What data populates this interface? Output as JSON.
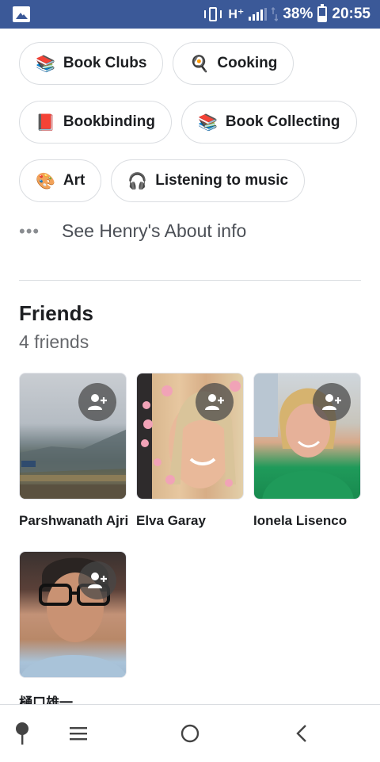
{
  "status_bar": {
    "network_label": "H⁺",
    "battery_percent": "38%",
    "battery_level": 0.38,
    "time": "20:55",
    "color": "#3b5998",
    "icons": [
      "gallery-icon",
      "vibrate-icon",
      "signal-icon",
      "data-arrows-icon",
      "battery-charging-icon"
    ]
  },
  "interests": [
    {
      "emoji": "📚",
      "label": "Book Clubs"
    },
    {
      "emoji": "🍳",
      "label": "Cooking"
    },
    {
      "emoji": "📕",
      "label": "Bookbinding"
    },
    {
      "emoji": "📚",
      "label": "Book Collecting"
    },
    {
      "emoji": "🎨",
      "label": "Art"
    },
    {
      "emoji": "🎧",
      "label": "Listening to music"
    }
  ],
  "about_link": {
    "icon": "more-dots-icon",
    "label": "See Henry's About info"
  },
  "friends": {
    "title": "Friends",
    "count_label": "4 friends",
    "add_friend_icon": "add-friend-icon",
    "list": [
      {
        "name": "Parshwanath Ajri"
      },
      {
        "name": "Elva Garay"
      },
      {
        "name": "Ionela Lisenco"
      },
      {
        "name": "樋口雄一"
      }
    ]
  },
  "nav_bar": {
    "icons": [
      "pin-icon",
      "menu-icon",
      "home-circle-icon",
      "back-chevron-icon"
    ]
  }
}
